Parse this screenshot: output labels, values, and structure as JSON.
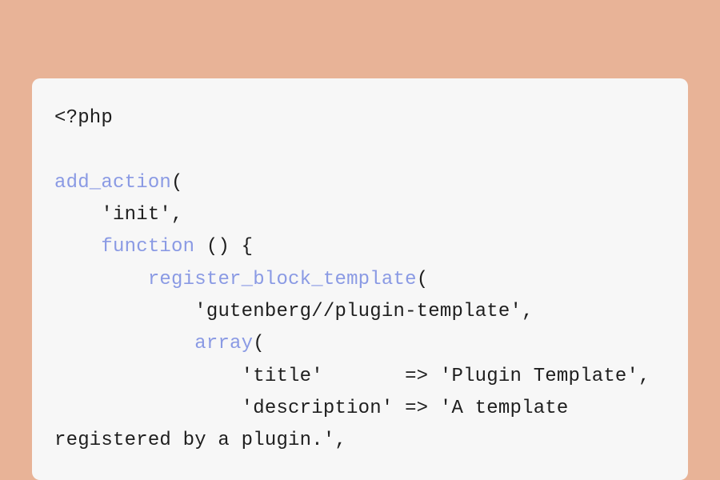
{
  "code": {
    "l1": "<?php",
    "l2": "",
    "l3_fn": "add_action",
    "l3_rest": "(",
    "l4": "    'init',",
    "l5_pad": "    ",
    "l5_kw": "function",
    "l5_rest": " () {",
    "l6_pad": "        ",
    "l6_fn": "register_block_template",
    "l6_rest": "(",
    "l7": "            'gutenberg//plugin-template',",
    "l8_pad": "            ",
    "l8_kw": "array",
    "l8_rest": "(",
    "l9": "                'title'       => 'Plugin Template',",
    "l10": "                'description' => 'A template registered by a plugin.',"
  }
}
